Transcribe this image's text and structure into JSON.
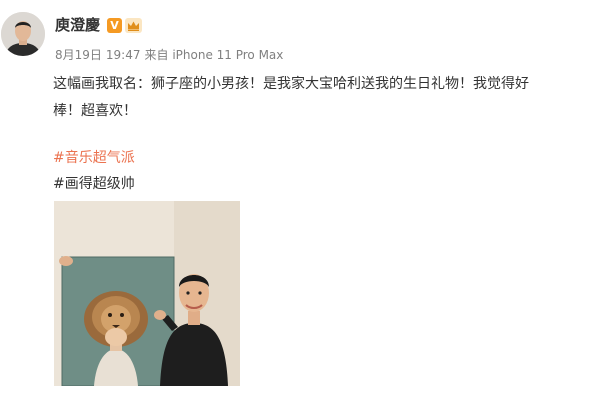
{
  "post": {
    "author": {
      "name": "庾澄慶",
      "verified_badge": "V",
      "crown_icon": "crown-icon"
    },
    "meta": {
      "date": "8月19日",
      "time": "19:47",
      "source": "来自 iPhone 11 Pro Max"
    },
    "text": "这幅画我取名：狮子座的小男孩！是我家大宝哈利送我的生日礼物！我觉得好棒！超喜欢！",
    "hashtags": [
      "#音乐超气派",
      "#画得超级帅"
    ],
    "photo": {
      "icon": "lion-boy-painting-photo"
    }
  },
  "colors": {
    "hashtag_accent": "#eb7350",
    "meta_gray": "#808080",
    "badge_orange": "#f59a23"
  }
}
